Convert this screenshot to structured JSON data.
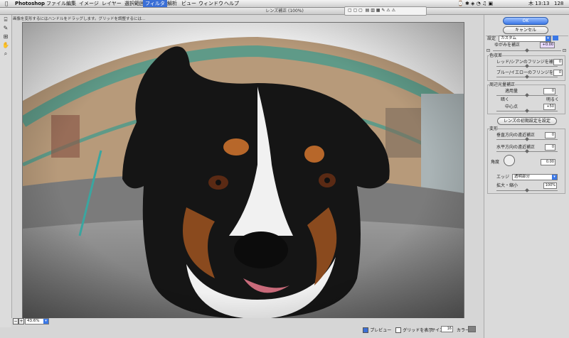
{
  "menubar": {
    "apple": "",
    "items": [
      "Photoshop",
      "ファイル",
      "編集",
      "イメージ",
      "レイヤー",
      "選択範囲",
      "フィルタ",
      "解析",
      "ビュー",
      "ウィンドウ",
      "ヘルプ"
    ],
    "active_index": 6,
    "clock": "木 13:13",
    "extra": "128"
  },
  "dialog": {
    "title": "レンズ補正 (100%)"
  },
  "hint": "画像を変形するにはハンドルをドラッグします。グリッドを調整するには...",
  "tools": [
    "remove-distortion-icon",
    "straighten-icon",
    "move-grid-icon",
    "hand-icon",
    "zoom-icon"
  ],
  "bottom": {
    "zoom": "43.6%",
    "preview_label": "プレビュー",
    "preview_checked": true,
    "grid_label": "グリッドを表示",
    "grid_size_label": "サイズ",
    "grid_size_value": "16",
    "color_label": "カラー",
    "color_swatch": "#808080"
  },
  "panel": {
    "ok_label": "OK",
    "cancel_label": "キャンセル",
    "setting_label": "設定",
    "setting_value": "カスタム",
    "remove_distortion_label": "ゆがみを補正",
    "remove_distortion_value": "+0.00",
    "chromatic_label": "色収差",
    "fix_red_cyan_label": "レッド/シアンのフリンジを補正",
    "fix_red_cyan_value": "0",
    "fix_blue_yellow_label": "ブルー/イエローのフリンジを補正",
    "fix_blue_yellow_value": "0",
    "vignette_label": "周辺光量補正",
    "amount_label": "適用量",
    "amount_value": "0",
    "darken_label": "暗く",
    "lighten_label": "明るく",
    "midpoint_label": "中心点",
    "midpoint_value": "+50",
    "set_default_label": "レンズの初期設定を設定",
    "transform_label": "変形",
    "vertical_label": "垂直方向の遠近補正",
    "vertical_value": "0",
    "horizontal_label": "水平方向の遠近補正",
    "horizontal_value": "0",
    "angle_label": "角度",
    "angle_value": "0.00",
    "edge_label": "エッジ",
    "edge_value": "透明部分",
    "scale_label": "拡大・縮小",
    "scale_value": "100%",
    "remove_distortion_frac": 0.5,
    "vertical_frac": 0.5,
    "horizontal_frac": 0.5,
    "amount_frac": 0.5,
    "midpoint_frac": 0.5,
    "scale_frac": 0.5
  }
}
